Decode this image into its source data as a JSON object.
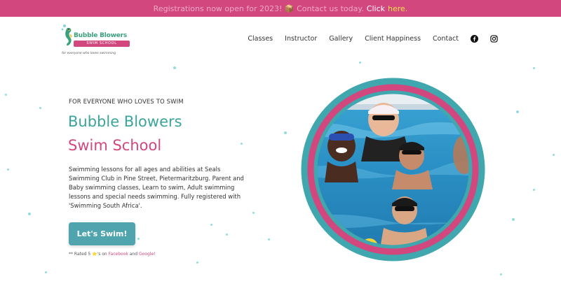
{
  "promo": {
    "text": "Registrations now open for 2023! 📦 Contact us today.",
    "cta": "Click",
    "cta_link": "here."
  },
  "logo": {
    "title": "Bubble Blowers",
    "subtitle": "SWIM SCHOOL",
    "tagline": "for everyone who loves swimming"
  },
  "nav": {
    "items": [
      "Classes",
      "Instructor",
      "Gallery",
      "Client Happiness",
      "Contact"
    ],
    "icons": [
      "facebook-icon",
      "instagram-icon"
    ]
  },
  "hero": {
    "tagline": "FOR EVERYONE WHO LOVES TO SWIM",
    "title_line1": "Bubble Blowers",
    "title_line2": "Swim School",
    "description": "Swimming lessons for all ages and abilities at Seals Swimming Club in Pine Street, Pietermaritzburg. Parent and Baby swimming classes, Learn to swim, Adult swimming lessons and special needs swimming. Fully registered with 'Swimming South Africa'.",
    "button": "Let's Swim!",
    "rated_prefix": "** Rated 5 ⭐'s on",
    "rated_link1": "Facebook",
    "rated_and": "and",
    "rated_link2": "Google!"
  },
  "colors": {
    "pink": "#d1477e",
    "teal": "#3aa59a",
    "button": "#4fa4ae",
    "bubble": "#7fd6dc"
  }
}
